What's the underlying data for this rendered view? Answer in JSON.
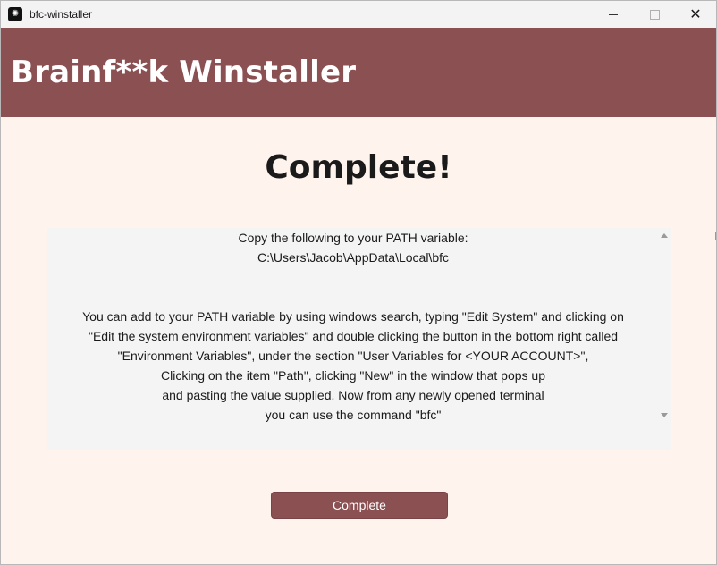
{
  "window": {
    "title": "bfc-winstaller",
    "controls": {
      "minimize": "minimize",
      "maximize": "maximize",
      "close": "✕"
    }
  },
  "header": {
    "title": "Brainf**k Winstaller"
  },
  "main": {
    "title": "Complete!",
    "info_lines_top": [
      "Copy the following to your PATH variable:",
      "C:\\Users\\Jacob\\AppData\\Local\\bfc"
    ],
    "info_lines_bottom": [
      "You can add to your PATH variable by using windows search, typing \"Edit System\" and clicking on",
      "\"Edit the system environment variables\" and double clicking the button in the bottom right called",
      "\"Environment Variables\", under the section \"User Variables for <YOUR ACCOUNT>\",",
      "Clicking on the item \"Path\", clicking \"New\" in the window that pops up",
      "and pasting the value supplied. Now from any newly opened terminal",
      "you can use the command \"bfc\""
    ],
    "complete_button": "Complete"
  }
}
